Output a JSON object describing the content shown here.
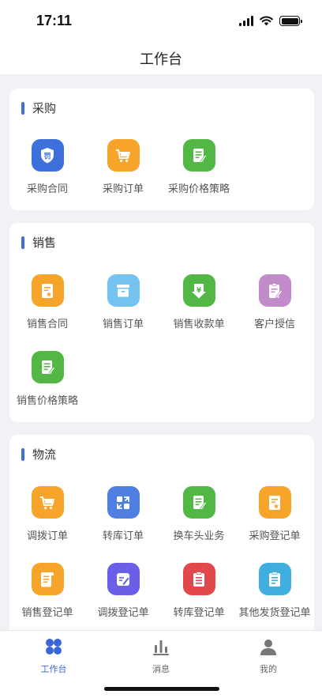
{
  "status_bar": {
    "time": "17:11"
  },
  "header": {
    "title": "工作台"
  },
  "sections": [
    {
      "title": "采购",
      "items": [
        {
          "label": "采购合同",
          "icon": "contract-penalty-icon",
          "color": "#3e70dc"
        },
        {
          "label": "采购订单",
          "icon": "cart-icon",
          "color": "#f7a42a"
        },
        {
          "label": "采购价格策略",
          "icon": "document-edit-icon",
          "color": "#53b745"
        }
      ]
    },
    {
      "title": "销售",
      "items": [
        {
          "label": "销售合同",
          "icon": "contract-star-icon",
          "color": "#f7a42a"
        },
        {
          "label": "销售订单",
          "icon": "archive-box-icon",
          "color": "#74c2ef"
        },
        {
          "label": "销售收款单",
          "icon": "yuan-download-icon",
          "color": "#53b745"
        },
        {
          "label": "客户授信",
          "icon": "clipboard-edit-icon",
          "color": "#c28bc9"
        },
        {
          "label": "销售价格策略",
          "icon": "document-edit-icon",
          "color": "#53b745"
        }
      ]
    },
    {
      "title": "物流",
      "items": [
        {
          "label": "调拨订单",
          "icon": "cart-icon",
          "color": "#f7a42a"
        },
        {
          "label": "转库订单",
          "icon": "transfer-icon",
          "color": "#4f7fe0"
        },
        {
          "label": "换车头业务",
          "icon": "document-edit-icon",
          "color": "#53b745"
        },
        {
          "label": "采购登记单",
          "icon": "contract-star-icon",
          "color": "#f7a42a"
        },
        {
          "label": "销售登记单",
          "icon": "scroll-icon",
          "color": "#f7a42a"
        },
        {
          "label": "调拨登记单",
          "icon": "form-edit-icon",
          "color": "#6a5fe6"
        },
        {
          "label": "转库登记单",
          "icon": "clipboard-list-icon",
          "color": "#e0484b"
        },
        {
          "label": "其他发货登记单",
          "icon": "clipboard-check-icon",
          "color": "#41aee0"
        }
      ]
    }
  ],
  "tab_bar": {
    "tabs": [
      {
        "label": "工作台",
        "icon": "workbench-icon",
        "active": true
      },
      {
        "label": "消息",
        "icon": "message-chart-icon",
        "active": false
      },
      {
        "label": "我的",
        "icon": "user-icon",
        "active": false
      }
    ],
    "active_color": "#3a66d6"
  }
}
